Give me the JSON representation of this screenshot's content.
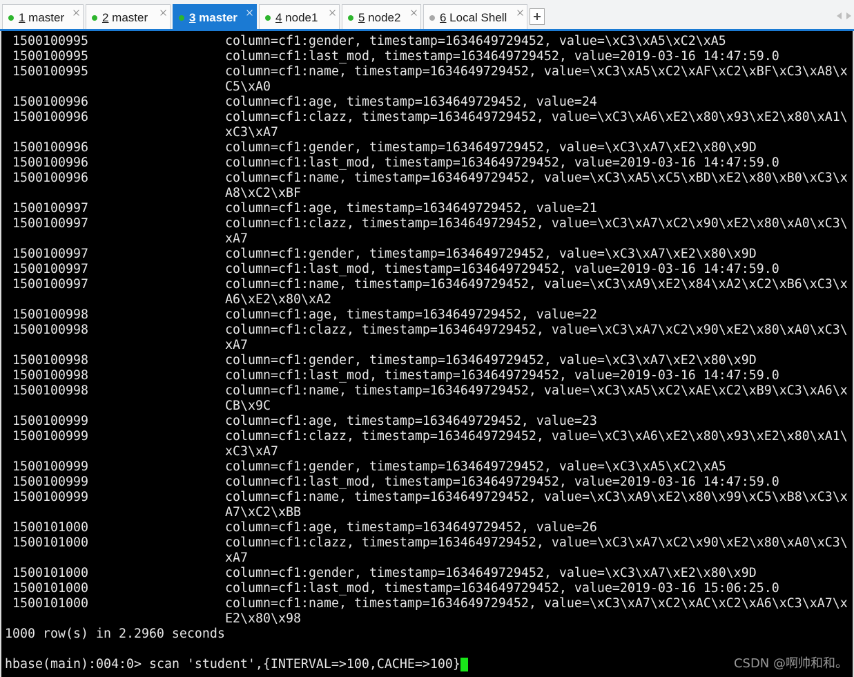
{
  "window": {
    "tabs": [
      {
        "num": "1",
        "name": "master",
        "dot_color": "#2db52d",
        "active": false
      },
      {
        "num": "2",
        "name": "master",
        "dot_color": "#2db52d",
        "active": false
      },
      {
        "num": "3",
        "name": "master",
        "dot_color": "#2db52d",
        "active": true
      },
      {
        "num": "4",
        "name": "node1",
        "dot_color": "#2db52d",
        "active": false
      },
      {
        "num": "5",
        "name": "node2",
        "dot_color": "#2db52d",
        "active": false
      },
      {
        "num": "6",
        "name": "Local Shell",
        "dot_color": "#a8a8a8",
        "active": false
      }
    ]
  },
  "icons": {
    "session_status": "status-dot-icon",
    "tab_close": "close-icon",
    "new_tab": "plus-icon",
    "scroll_left": "triangle-left-icon",
    "scroll_right": "triangle-right-icon"
  },
  "colors": {
    "accent": "#1b7ad3",
    "terminal_bg": "#000000",
    "terminal_fg": "#e6e6e6",
    "cursor": "#19e619",
    "connected_dot": "#2db52d",
    "watermark": "#9a9a9a"
  },
  "terminal": {
    "lines": [
      {
        "key": "1500100995",
        "text": "column=cf1:gender, timestamp=1634649729452, value=\\xC3\\xA5\\xC2\\xA5"
      },
      {
        "key": "1500100995",
        "text": "column=cf1:last_mod, timestamp=1634649729452, value=2019-03-16 14:47:59.0"
      },
      {
        "key": "1500100995",
        "text": "column=cf1:name, timestamp=1634649729452, value=\\xC3\\xA5\\xC2\\xAF\\xC2\\xBF\\xC3\\xA8\\x"
      },
      {
        "text": "C5\\xA0"
      },
      {
        "key": "1500100996",
        "text": "column=cf1:age, timestamp=1634649729452, value=24"
      },
      {
        "key": "1500100996",
        "text": "column=cf1:clazz, timestamp=1634649729452, value=\\xC3\\xA6\\xE2\\x80\\x93\\xE2\\x80\\xA1\\"
      },
      {
        "text": "xC3\\xA7"
      },
      {
        "key": "1500100996",
        "text": "column=cf1:gender, timestamp=1634649729452, value=\\xC3\\xA7\\xE2\\x80\\x9D"
      },
      {
        "key": "1500100996",
        "text": "column=cf1:last_mod, timestamp=1634649729452, value=2019-03-16 14:47:59.0"
      },
      {
        "key": "1500100996",
        "text": "column=cf1:name, timestamp=1634649729452, value=\\xC3\\xA5\\xC5\\xBD\\xE2\\x80\\xB0\\xC3\\x"
      },
      {
        "text": "A8\\xC2\\xBF"
      },
      {
        "key": "1500100997",
        "text": "column=cf1:age, timestamp=1634649729452, value=21"
      },
      {
        "key": "1500100997",
        "text": "column=cf1:clazz, timestamp=1634649729452, value=\\xC3\\xA7\\xC2\\x90\\xE2\\x80\\xA0\\xC3\\"
      },
      {
        "text": "xA7"
      },
      {
        "key": "1500100997",
        "text": "column=cf1:gender, timestamp=1634649729452, value=\\xC3\\xA7\\xE2\\x80\\x9D"
      },
      {
        "key": "1500100997",
        "text": "column=cf1:last_mod, timestamp=1634649729452, value=2019-03-16 14:47:59.0"
      },
      {
        "key": "1500100997",
        "text": "column=cf1:name, timestamp=1634649729452, value=\\xC3\\xA9\\xE2\\x84\\xA2\\xC2\\xB6\\xC3\\x"
      },
      {
        "text": "A6\\xE2\\x80\\xA2"
      },
      {
        "key": "1500100998",
        "text": "column=cf1:age, timestamp=1634649729452, value=22"
      },
      {
        "key": "1500100998",
        "text": "column=cf1:clazz, timestamp=1634649729452, value=\\xC3\\xA7\\xC2\\x90\\xE2\\x80\\xA0\\xC3\\"
      },
      {
        "text": "xA7"
      },
      {
        "key": "1500100998",
        "text": "column=cf1:gender, timestamp=1634649729452, value=\\xC3\\xA7\\xE2\\x80\\x9D"
      },
      {
        "key": "1500100998",
        "text": "column=cf1:last_mod, timestamp=1634649729452, value=2019-03-16 14:47:59.0"
      },
      {
        "key": "1500100998",
        "text": "column=cf1:name, timestamp=1634649729452, value=\\xC3\\xA5\\xC2\\xAE\\xC2\\xB9\\xC3\\xA6\\x"
      },
      {
        "text": "CB\\x9C"
      },
      {
        "key": "1500100999",
        "text": "column=cf1:age, timestamp=1634649729452, value=23"
      },
      {
        "key": "1500100999",
        "text": "column=cf1:clazz, timestamp=1634649729452, value=\\xC3\\xA6\\xE2\\x80\\x93\\xE2\\x80\\xA1\\"
      },
      {
        "text": "xC3\\xA7"
      },
      {
        "key": "1500100999",
        "text": "column=cf1:gender, timestamp=1634649729452, value=\\xC3\\xA5\\xC2\\xA5"
      },
      {
        "key": "1500100999",
        "text": "column=cf1:last_mod, timestamp=1634649729452, value=2019-03-16 14:47:59.0"
      },
      {
        "key": "1500100999",
        "text": "column=cf1:name, timestamp=1634649729452, value=\\xC3\\xA9\\xE2\\x80\\x99\\xC5\\xB8\\xC3\\x"
      },
      {
        "text": "A7\\xC2\\xBB"
      },
      {
        "key": "1500101000",
        "text": "column=cf1:age, timestamp=1634649729452, value=26"
      },
      {
        "key": "1500101000",
        "text": "column=cf1:clazz, timestamp=1634649729452, value=\\xC3\\xA7\\xC2\\x90\\xE2\\x80\\xA0\\xC3\\"
      },
      {
        "text": "xA7"
      },
      {
        "key": "1500101000",
        "text": "column=cf1:gender, timestamp=1634649729452, value=\\xC3\\xA7\\xE2\\x80\\x9D"
      },
      {
        "key": "1500101000",
        "text": "column=cf1:last_mod, timestamp=1634649729452, value=2019-03-16 15:06:25.0"
      },
      {
        "key": "1500101000",
        "text": "column=cf1:name, timestamp=1634649729452, value=\\xC3\\xA7\\xC2\\xAC\\xC2\\xA6\\xC3\\xA7\\x"
      },
      {
        "text": "E2\\x80\\x98"
      }
    ],
    "summary": "1000 row(s) in 2.2960 seconds",
    "prompt": "hbase(main):004:0> ",
    "command": "scan 'student',{INTERVAL=>100,CACHE=>100}"
  },
  "watermark": "CSDN @啊帅和和。"
}
